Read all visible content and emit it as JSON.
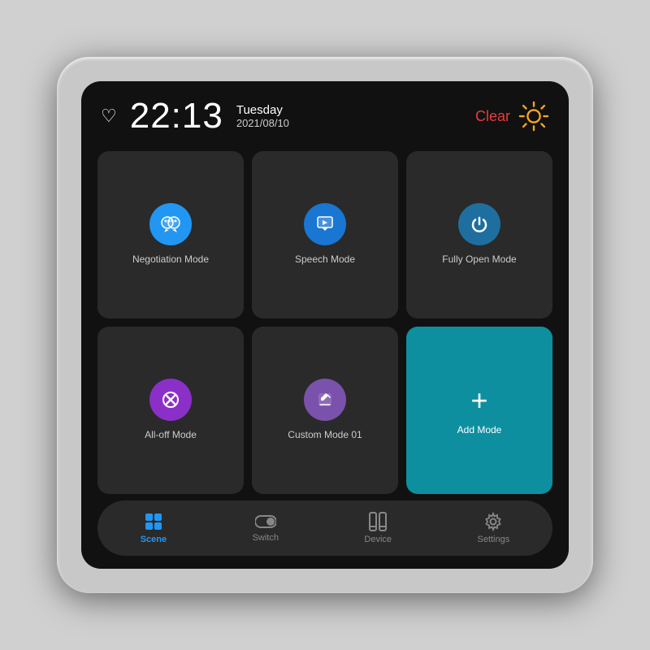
{
  "header": {
    "time": "22:13",
    "day": "Tuesday",
    "date": "2021/08/10",
    "weather_label": "Clear",
    "heart_icon": "♡"
  },
  "grid": {
    "items": [
      {
        "id": "negotiation-mode",
        "label": "Negotiation Mode",
        "icon_type": "chat",
        "icon_class": "icon-blue",
        "teal": false
      },
      {
        "id": "speech-mode",
        "label": "Speech Mode",
        "icon_type": "presentation",
        "icon_class": "icon-blue-mid",
        "teal": false
      },
      {
        "id": "fully-open-mode",
        "label": "Fully Open Mode",
        "icon_type": "power",
        "icon_class": "icon-power",
        "teal": false
      },
      {
        "id": "all-off-mode",
        "label": "All-off Mode",
        "icon_type": "close",
        "icon_class": "icon-purple-red",
        "teal": false
      },
      {
        "id": "custom-mode",
        "label": "Custom Mode 01",
        "icon_type": "pencil",
        "icon_class": "icon-purple",
        "teal": false
      },
      {
        "id": "add-mode",
        "label": "Add Mode",
        "icon_type": "plus",
        "icon_class": "",
        "teal": true
      }
    ]
  },
  "nav": {
    "items": [
      {
        "id": "scene",
        "label": "Scene",
        "icon": "scene",
        "active": true
      },
      {
        "id": "switch",
        "label": "Switch",
        "icon": "switch",
        "active": false
      },
      {
        "id": "device",
        "label": "Device",
        "icon": "device",
        "active": false
      },
      {
        "id": "settings",
        "label": "Settings",
        "icon": "settings",
        "active": false
      }
    ]
  }
}
